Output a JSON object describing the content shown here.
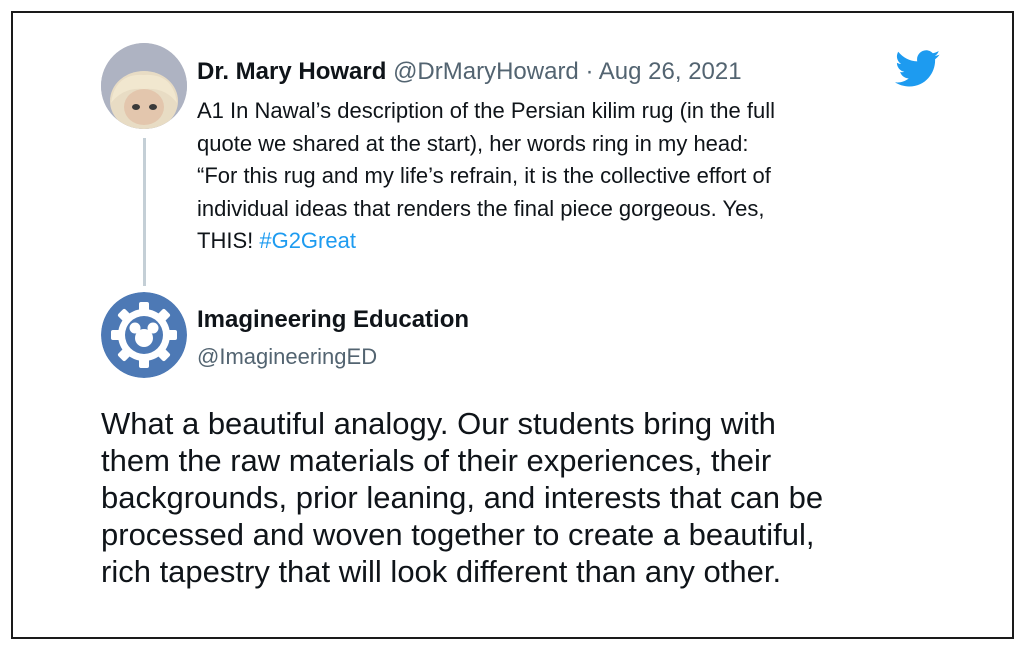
{
  "tweet": {
    "author_name": "Dr. Mary Howard",
    "author_handle": "@DrMaryHoward",
    "separator": " · ",
    "date": "Aug 26, 2021",
    "lines": [
      "A1 In Nawal’s description of the Persian kilim rug (in the full",
      "quote we shared at the start), her words ring in my head:",
      "“For this rug and my life’s refrain, it is the collective effort of",
      "individual ideas that renders the final piece gorgeous. Yes,"
    ],
    "last_line_text": "THIS! ",
    "hashtag": "#G2Great",
    "icon": "twitter-bird-icon",
    "brand_color": "#1d9bf0"
  },
  "reply": {
    "author_name": "Imagineering Education",
    "author_handle": "@ImagineeringED",
    "avatar_icon": "gear-mouse-icon",
    "avatar_color": "#4d79b5",
    "lines": [
      "What a beautiful analogy. Our students bring with",
      "them the raw materials of their experiences, their",
      "backgrounds, prior leaning, and interests that can be",
      "processed and woven together to create a beautiful,",
      "rich tapestry that will look different than any other."
    ]
  }
}
